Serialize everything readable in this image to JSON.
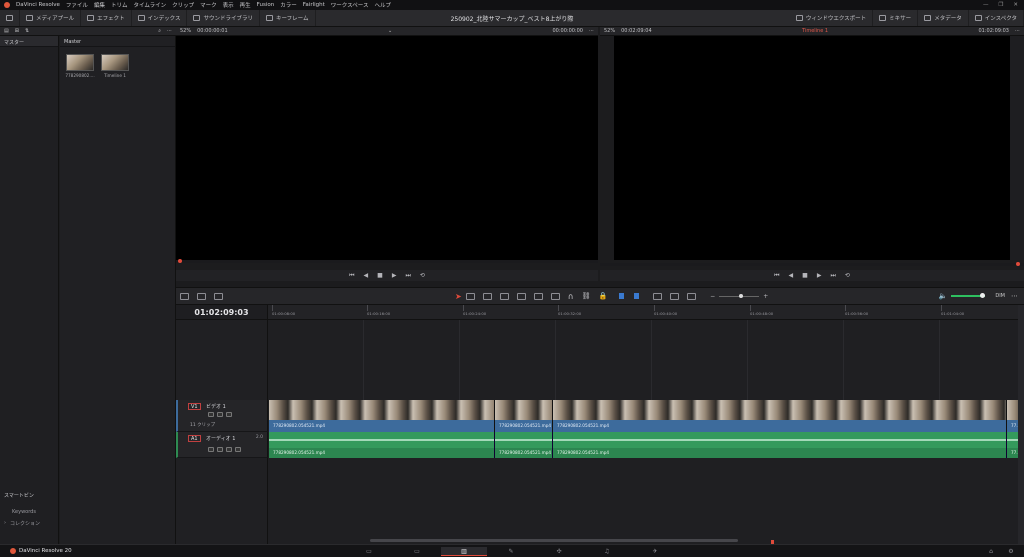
{
  "menubar": {
    "app_name": "DaVinci Resolve",
    "items": [
      "ファイル",
      "編集",
      "トリム",
      "タイムライン",
      "クリップ",
      "マーク",
      "表示",
      "再生",
      "Fusion",
      "カラー",
      "Fairlight",
      "ワークスペース",
      "ヘルプ"
    ]
  },
  "toolbar": {
    "media_pool": "メディアプール",
    "effects": "エフェクト",
    "index": "インデックス",
    "sound_library": "サウンドライブラリ",
    "keyframe": "キーフレーム",
    "project_title": "250902_北陸サマーカップ_ベスト8上がり際",
    "right_items": [
      "ウィンドウエクスポート",
      "ミキサー",
      "メタデータ",
      "インスペクタ"
    ]
  },
  "source_viewer": {
    "zoom": "52%",
    "timecode_left": "00:00:00:01",
    "timecode_right": "00:00:00:00"
  },
  "timeline_viewer": {
    "zoom": "52%",
    "timecode_left": "00:02:09:04",
    "timeline_name": "Timeline 1",
    "timecode_right": "01:02:09:03"
  },
  "sidebar": {
    "header": "マスター",
    "smart_bins": "スマートビン",
    "keywords": "Keywords",
    "collections": "コレクション"
  },
  "bin": {
    "header": "Master",
    "clips": [
      {
        "label": "7782908​02...."
      },
      {
        "label": "Timeline 1"
      }
    ]
  },
  "timeline": {
    "current_timecode": "01:02:09:03",
    "ruler_labels": [
      "01:00:08:00",
      "01:00:16:00",
      "01:00:24:00",
      "01:00:32:00",
      "01:00:40:00",
      "01:00:48:00",
      "01:00:56:00",
      "01:01:04:00"
    ],
    "dim_label": "DIM",
    "tracks": {
      "video": {
        "badge": "V1",
        "name": "ビデオ 1",
        "clip_count": "11 クリップ"
      },
      "audio": {
        "badge": "A1",
        "name": "オーディオ 1",
        "format": "2.0"
      }
    },
    "video_clips": [
      "778290802.054521.mp4",
      "778290802.054521.mp4",
      "778290802.054521.mp4",
      "77..."
    ],
    "audio_clips": [
      "778290802.054521.mp4",
      "778290802.054521.mp4",
      "778290802.054521.mp4",
      "77..."
    ]
  },
  "pagebar": {
    "app_name": "DaVinci Resolve 20"
  }
}
